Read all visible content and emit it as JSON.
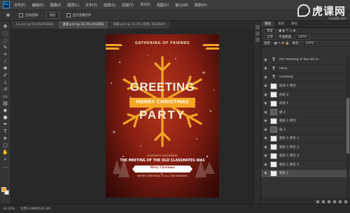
{
  "menu": {
    "logo": "Ps",
    "items": [
      "文件(F)",
      "编辑(E)",
      "图像(I)",
      "图层(L)",
      "文字(Y)",
      "选择(S)",
      "滤镜(T)",
      "3D(D)",
      "视图(V)",
      "窗口(W)",
      "帮助(H)"
    ]
  },
  "watermark": {
    "text": "虎课网",
    "url": "huke88.com"
  },
  "options": {
    "auto_select": "自动选择:",
    "target": "图层",
    "show_transform": "显示变换控件"
  },
  "tabs": [
    {
      "label": "11.psd @ 59.8%(RGB/8)"
    },
    {
      "label": "圣诞.psd @ 33.3% (RGB/8)"
    },
    {
      "label": "海报.psd @ 33.3% (效果, RGB/8#)"
    }
  ],
  "poster": {
    "top_text": "GATHERING OF FRIENDS",
    "greeting": "GREETING",
    "merry": "MERRY CHRISTMAS",
    "party": "PARTY",
    "society": "A SOCIETY GATHERING",
    "meeting": "THE MEETING OF THE OLD CLASSMATES WAS",
    "ribbon": "Merry Christmas",
    "bottom": "MERRY CHRISTMAS TO ALL OUR READERS",
    "accent": "#f5a623"
  },
  "status": {
    "zoom": "33.33%",
    "doc": "文档:6.98M/142.3M"
  },
  "panel": {
    "tabs": [
      "图层",
      "通道",
      "路径"
    ],
    "filter": "类型",
    "blend": "正常",
    "opacity_label": "不透明度:",
    "opacity": "100%",
    "lock_label": "锁定:",
    "fill_label": "填充:",
    "fill": "100%"
  },
  "layers": [
    {
      "name": "the meeting of the old cl...",
      "type": "text",
      "selected": false
    },
    {
      "name": "Party",
      "type": "text",
      "selected": false
    },
    {
      "name": "Greeting",
      "type": "text",
      "selected": false
    },
    {
      "name": "形状 1 拷贝",
      "type": "shape",
      "selected": false
    },
    {
      "name": "形状 2",
      "type": "shape",
      "selected": false
    },
    {
      "name": "形状 1",
      "type": "shape",
      "selected": false
    },
    {
      "name": "组 4",
      "type": "folder",
      "selected": false
    },
    {
      "name": "矩形 1 拷贝",
      "type": "shape",
      "selected": false
    },
    {
      "name": "组 3",
      "type": "folder",
      "selected": false
    },
    {
      "name": "矩形 1 拷贝 3",
      "type": "shape",
      "selected": false
    },
    {
      "name": "矩形 1 拷贝 2",
      "type": "shape",
      "selected": false
    },
    {
      "name": "矩形 1 拷贝 4",
      "type": "shape",
      "selected": false
    },
    {
      "name": "矩形 1 拷贝 5",
      "type": "shape",
      "selected": false
    },
    {
      "name": "矩形 1",
      "type": "shape",
      "selected": true
    }
  ]
}
